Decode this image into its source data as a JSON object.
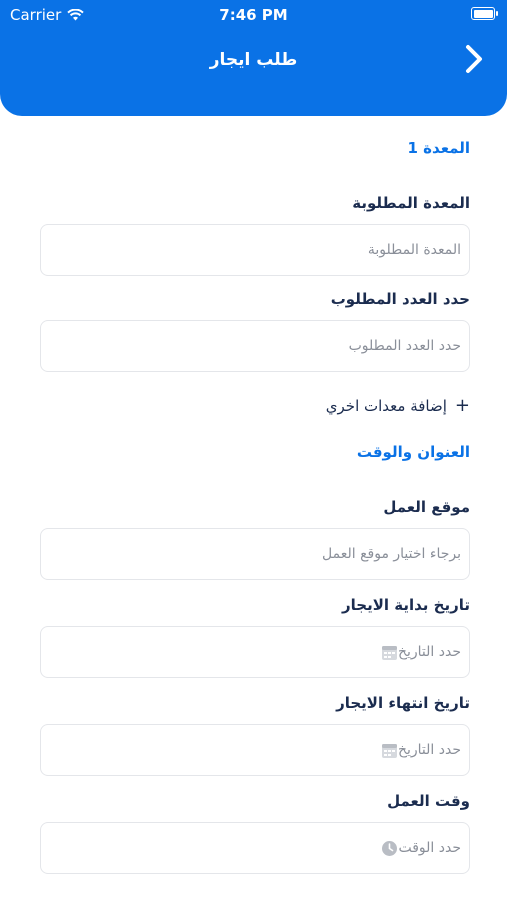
{
  "status_bar": {
    "carrier": "Carrier",
    "time": "7:46 PM"
  },
  "header": {
    "title": "طلب ايجار"
  },
  "equipment_section": {
    "title": "المعدة 1",
    "equipment_label": "المعدة المطلوبة",
    "equipment_placeholder": "المعدة المطلوبة",
    "count_label": "حدد العدد المطلوب",
    "count_placeholder": "حدد العدد المطلوب",
    "add_more_label": "إضافة معدات اخري"
  },
  "address_section": {
    "title": "العنوان والوقت",
    "location_label": "موقع العمل",
    "location_placeholder": "برجاء اختيار موقع العمل",
    "start_date_label": "تاريخ بداية الايجار",
    "start_date_placeholder": "حدد التاريخ",
    "end_date_label": "تاريخ انتهاء الايجار",
    "end_date_placeholder": "حدد التاريخ",
    "work_time_label": "وقت العمل",
    "work_time_placeholder": "حدد الوقت"
  }
}
